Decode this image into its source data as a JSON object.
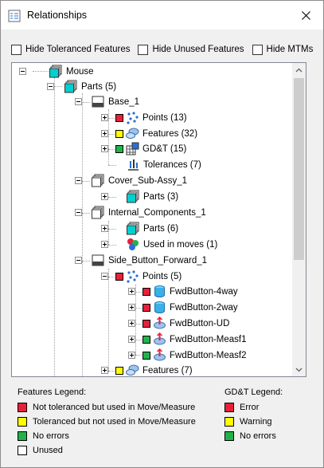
{
  "window": {
    "title": "Relationships"
  },
  "filters": [
    {
      "label": "Hide Toleranced Features",
      "checked": false
    },
    {
      "label": "Hide Unused Features",
      "checked": false
    },
    {
      "label": "Hide MTMs",
      "checked": false
    }
  ],
  "tree": {
    "mouse": "Mouse",
    "parts_root": "Parts (5)",
    "base": "Base_1",
    "base_points": "Points (13)",
    "base_features": "Features (32)",
    "base_gdt": "GD&T (15)",
    "base_tolerances": "Tolerances (7)",
    "cover": "Cover_Sub-Assy_1",
    "cover_parts": "Parts (3)",
    "internal": "Internal_Components_1",
    "internal_parts": "Parts (6)",
    "internal_moves": "Used in moves (1)",
    "side": "Side_Button_Forward_1",
    "side_points": "Points (5)",
    "pt1": "FwdButton-4way",
    "pt2": "FwdButton-2way",
    "pt3": "FwdButton-UD",
    "pt4": "FwdButton-Measf1",
    "pt5": "FwdButton-Measf2",
    "side_features": "Features (7)"
  },
  "colors": {
    "error": "#e8203c",
    "warning": "#ffff00",
    "ok": "#22b24c",
    "unused": "#ffffff"
  },
  "legend": {
    "features_title": "Features Legend:",
    "features": [
      {
        "label": "Not toleranced but used in Move/Measure",
        "status": "error"
      },
      {
        "label": "Toleranced but not used in Move/Measure",
        "status": "warning"
      },
      {
        "label": "No errors",
        "status": "ok"
      },
      {
        "label": "Unused",
        "status": "unused"
      }
    ],
    "gdt_title": "GD&T Legend:",
    "gdt": [
      {
        "label": "Error",
        "status": "error"
      },
      {
        "label": "Warning",
        "status": "warning"
      },
      {
        "label": "No errors",
        "status": "ok"
      }
    ]
  }
}
